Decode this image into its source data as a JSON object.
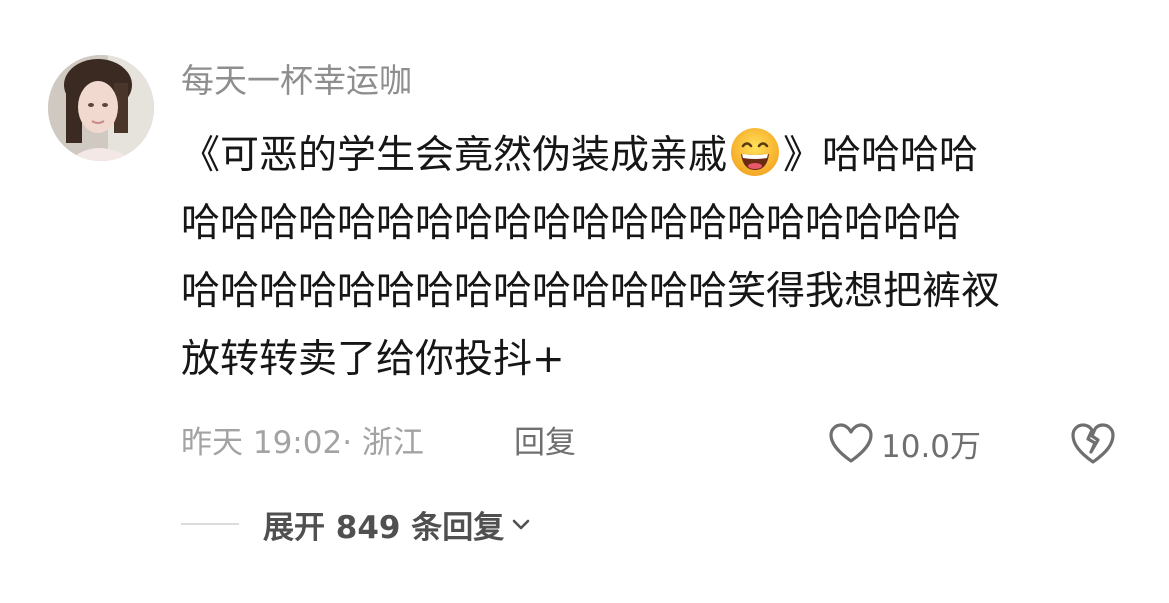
{
  "comment": {
    "username": "每天一杯幸运咖",
    "text_lines": [
      "《可恶的学生会竟然伪装成亲戚",
      "》哈哈哈哈",
      "哈哈哈哈哈哈哈哈哈哈哈哈哈哈哈哈哈哈哈哈",
      "哈哈哈哈哈哈哈哈哈哈哈哈哈哈笑得我想把裤衩",
      "放转转卖了给你投抖+"
    ],
    "emoji": "grinning-face-with-smiling-eyes",
    "time": "昨天 19:02",
    "location_sep": "·",
    "location": "浙江",
    "reply_label": "回复",
    "like_count": "10.0万"
  },
  "replies": {
    "expand_label": "展开 849 条回复"
  },
  "colors": {
    "username": "#8e8e8e",
    "meta": "#a3a3a3",
    "action": "#6f6f6f",
    "text": "#161616"
  }
}
